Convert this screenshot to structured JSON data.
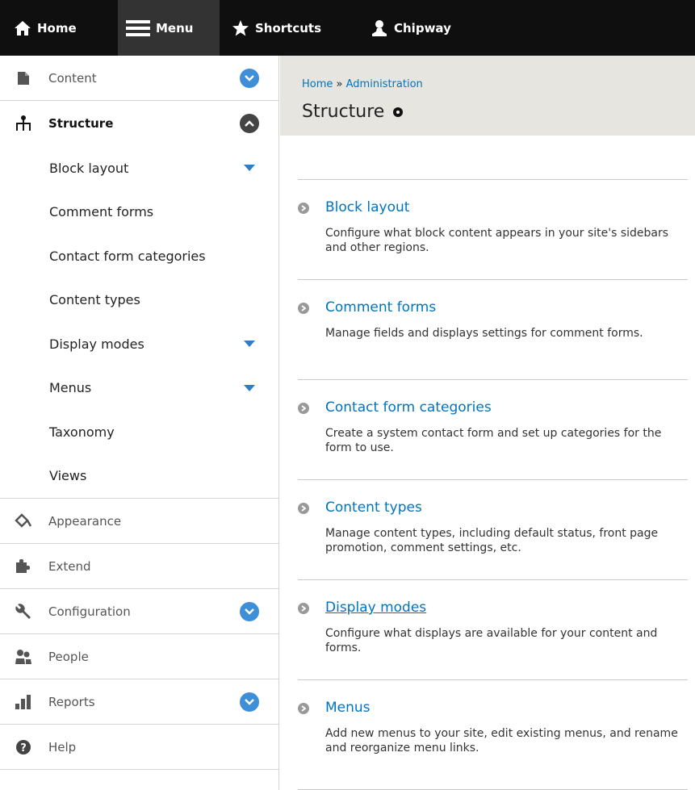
{
  "toolbar": {
    "home": "Home",
    "menu": "Menu",
    "shortcuts": "Shortcuts",
    "user": "Chipway"
  },
  "sidebar": {
    "content": "Content",
    "structure": "Structure",
    "children": [
      "Block layout",
      "Comment forms",
      "Contact form categories",
      "Content types",
      "Display modes",
      "Menus",
      "Taxonomy",
      "Views"
    ],
    "appearance": "Appearance",
    "extend": "Extend",
    "configuration": "Configuration",
    "people": "People",
    "reports": "Reports",
    "help": "Help"
  },
  "header": {
    "breadcrumb_home": "Home",
    "breadcrumb_sep": "»",
    "breadcrumb_admin": "Administration",
    "title": "Structure"
  },
  "admin_list": [
    {
      "title": "Block layout",
      "description": "Configure what block content appears in your site's sidebars and other regions."
    },
    {
      "title": "Comment forms",
      "description": "Manage fields and displays settings for comment forms."
    },
    {
      "title": "Contact form categories",
      "description": "Create a system contact form and set up categories for the form to use."
    },
    {
      "title": "Content types",
      "description": "Manage content types, including default status, front page promotion, comment settings, etc."
    },
    {
      "title": "Display modes",
      "description": "Configure what displays are available for your content and forms."
    },
    {
      "title": "Menus",
      "description": "Add new menus to your site, edit existing menus, and rename and reorganize menu links."
    }
  ],
  "colors": {
    "toolbar_bg": "#0f0f0f",
    "link": "#0074bd",
    "header_bg": "#e6e5df",
    "toggle_blue": "#3f8fd8"
  }
}
